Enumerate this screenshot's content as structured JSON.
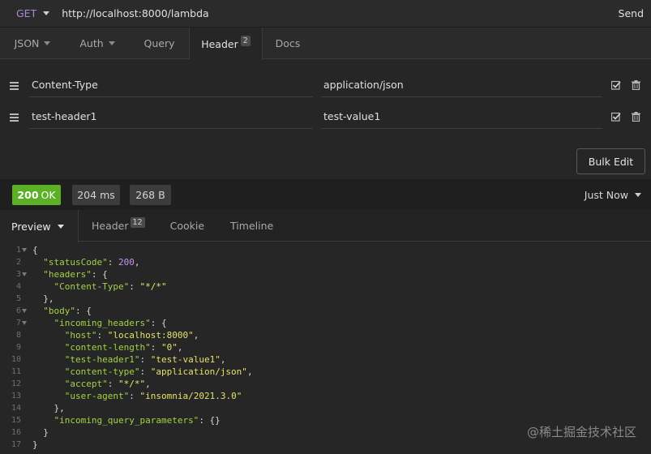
{
  "request": {
    "method": "GET",
    "url": "http://localhost:8000/lambda",
    "send_label": "Send"
  },
  "request_tabs": [
    {
      "label": "JSON",
      "dropdown": true
    },
    {
      "label": "Auth",
      "dropdown": true
    },
    {
      "label": "Query"
    },
    {
      "label": "Header",
      "badge": "2",
      "active": true
    },
    {
      "label": "Docs"
    }
  ],
  "headers": [
    {
      "name": "Content-Type",
      "value": "application/json",
      "enabled": true
    },
    {
      "name": "test-header1",
      "value": "test-value1",
      "enabled": true
    }
  ],
  "bulk_edit_label": "Bulk Edit",
  "response": {
    "status_code": "200",
    "status_text": "OK",
    "time": "204 ms",
    "size": "268 B",
    "when": "Just Now"
  },
  "response_tabs": [
    {
      "label": "Preview",
      "active": true,
      "dropdown": true
    },
    {
      "label": "Header",
      "badge": "12"
    },
    {
      "label": "Cookie"
    },
    {
      "label": "Timeline"
    }
  ],
  "code_lines": [
    {
      "n": "1",
      "fold": true,
      "parts": [
        [
          "p",
          "{"
        ]
      ]
    },
    {
      "n": "2",
      "parts": [
        [
          "p",
          "  "
        ],
        [
          "k",
          "\"statusCode\""
        ],
        [
          "p",
          ": "
        ],
        [
          "n",
          "200"
        ],
        [
          "p",
          ","
        ]
      ]
    },
    {
      "n": "3",
      "fold": true,
      "parts": [
        [
          "p",
          "  "
        ],
        [
          "k",
          "\"headers\""
        ],
        [
          "p",
          ": {"
        ]
      ]
    },
    {
      "n": "4",
      "parts": [
        [
          "p",
          "    "
        ],
        [
          "k",
          "\"Content-Type\""
        ],
        [
          "p",
          ": "
        ],
        [
          "s",
          "\"*/*\""
        ]
      ]
    },
    {
      "n": "5",
      "parts": [
        [
          "p",
          "  },"
        ]
      ]
    },
    {
      "n": "6",
      "fold": true,
      "parts": [
        [
          "p",
          "  "
        ],
        [
          "k",
          "\"body\""
        ],
        [
          "p",
          ": {"
        ]
      ]
    },
    {
      "n": "7",
      "fold": true,
      "parts": [
        [
          "p",
          "    "
        ],
        [
          "k",
          "\"incoming_headers\""
        ],
        [
          "p",
          ": {"
        ]
      ]
    },
    {
      "n": "8",
      "parts": [
        [
          "p",
          "      "
        ],
        [
          "k",
          "\"host\""
        ],
        [
          "p",
          ": "
        ],
        [
          "s",
          "\"localhost:8000\""
        ],
        [
          "p",
          ","
        ]
      ]
    },
    {
      "n": "9",
      "parts": [
        [
          "p",
          "      "
        ],
        [
          "k",
          "\"content-length\""
        ],
        [
          "p",
          ": "
        ],
        [
          "s",
          "\"0\""
        ],
        [
          "p",
          ","
        ]
      ]
    },
    {
      "n": "10",
      "parts": [
        [
          "p",
          "      "
        ],
        [
          "k",
          "\"test-header1\""
        ],
        [
          "p",
          ": "
        ],
        [
          "s",
          "\"test-value1\""
        ],
        [
          "p",
          ","
        ]
      ]
    },
    {
      "n": "11",
      "parts": [
        [
          "p",
          "      "
        ],
        [
          "k",
          "\"content-type\""
        ],
        [
          "p",
          ": "
        ],
        [
          "s",
          "\"application/json\""
        ],
        [
          "p",
          ","
        ]
      ]
    },
    {
      "n": "12",
      "parts": [
        [
          "p",
          "      "
        ],
        [
          "k",
          "\"accept\""
        ],
        [
          "p",
          ": "
        ],
        [
          "s",
          "\"*/*\""
        ],
        [
          "p",
          ","
        ]
      ]
    },
    {
      "n": "13",
      "parts": [
        [
          "p",
          "      "
        ],
        [
          "k",
          "\"user-agent\""
        ],
        [
          "p",
          ": "
        ],
        [
          "s",
          "\"insomnia/2021.3.0\""
        ]
      ]
    },
    {
      "n": "14",
      "parts": [
        [
          "p",
          "    },"
        ]
      ]
    },
    {
      "n": "15",
      "parts": [
        [
          "p",
          "    "
        ],
        [
          "k",
          "\"incoming_query_parameters\""
        ],
        [
          "p",
          ": {}"
        ]
      ]
    },
    {
      "n": "16",
      "parts": [
        [
          "p",
          "  }"
        ]
      ]
    },
    {
      "n": "17",
      "parts": [
        [
          "p",
          "}"
        ]
      ]
    }
  ],
  "watermark": "@稀土掘金技术社区",
  "colors": {
    "method": "#a98ad9",
    "status_ok": "#5bb025",
    "json_key": "#a6d147",
    "json_string": "#e2e36b",
    "json_number": "#c692f0"
  },
  "icons": [
    "chevron-down-icon",
    "drag-handle-icon",
    "checkbox-checked-icon",
    "trash-icon"
  ]
}
